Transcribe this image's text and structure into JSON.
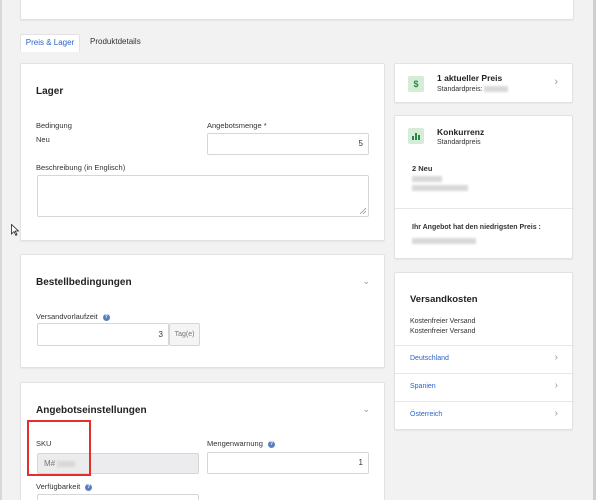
{
  "tabs": [
    {
      "label": "Preis & Lager"
    },
    {
      "label": "Produktdetails"
    }
  ],
  "lager": {
    "title": "Lager",
    "condition_label": "Bedingung",
    "condition_value": "Neu",
    "quantity_label": "Angebotsmenge",
    "quantity_required": "*",
    "quantity_value": "5",
    "description_label": "Beschreibung (in Englisch)"
  },
  "order_conditions": {
    "title": "Bestellbedingungen",
    "lead_time_label": "Versandvorlaufzeit",
    "lead_time_value": "3",
    "lead_time_unit": "Tag(e)"
  },
  "offer_settings": {
    "title": "Angebotseinstellungen",
    "sku_label": "SKU",
    "sku_value": "M#",
    "quantity_warning_label": "Mengenwarnung",
    "quantity_warning_value": "1",
    "availability_label": "Verfügbarkeit"
  },
  "price_panel": {
    "title": "1 aktueller Preis",
    "subtitle": "Standardpreis:",
    "icon": "dollar-icon"
  },
  "competition_panel": {
    "title": "Konkurrenz",
    "subtitle": "Standardpreis",
    "icon": "bar-chart-icon",
    "offer_count": "2 Neu",
    "lowest_price_text": "Ihr Angebot hat den niedrigsten Preis :"
  },
  "shipping_panel": {
    "title": "Versandkosten",
    "line1": "Kostenfreier Versand",
    "line2": "Kostenfreier Versand",
    "countries": [
      "Deutschland",
      "Spanien",
      "Österreich"
    ]
  },
  "colors": {
    "accent": "#2d63c8",
    "highlight": "#e0322b",
    "icon_green": "#2a8a3f"
  }
}
